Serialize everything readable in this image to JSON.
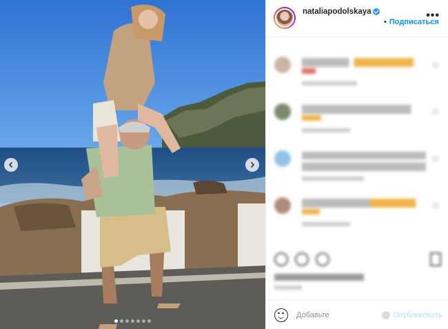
{
  "post": {
    "username": "nataliapodolskaya",
    "verified": true,
    "follow_label": "Подписаться",
    "separator": "•",
    "more_icon": "more-horizontal-icon",
    "carousel": {
      "slide_count": 7,
      "active_index": 0,
      "prev_icon": "chevron-left-icon",
      "next_icon": "chevron-right-icon"
    }
  },
  "comment_box": {
    "placeholder": "Добавьте",
    "post_label": "Опубликовать",
    "emoji_icon": "emoji-icon"
  },
  "colors": {
    "accent": "#0095f6",
    "verified": "#3897f0",
    "post_disabled": "#b2dffc"
  }
}
